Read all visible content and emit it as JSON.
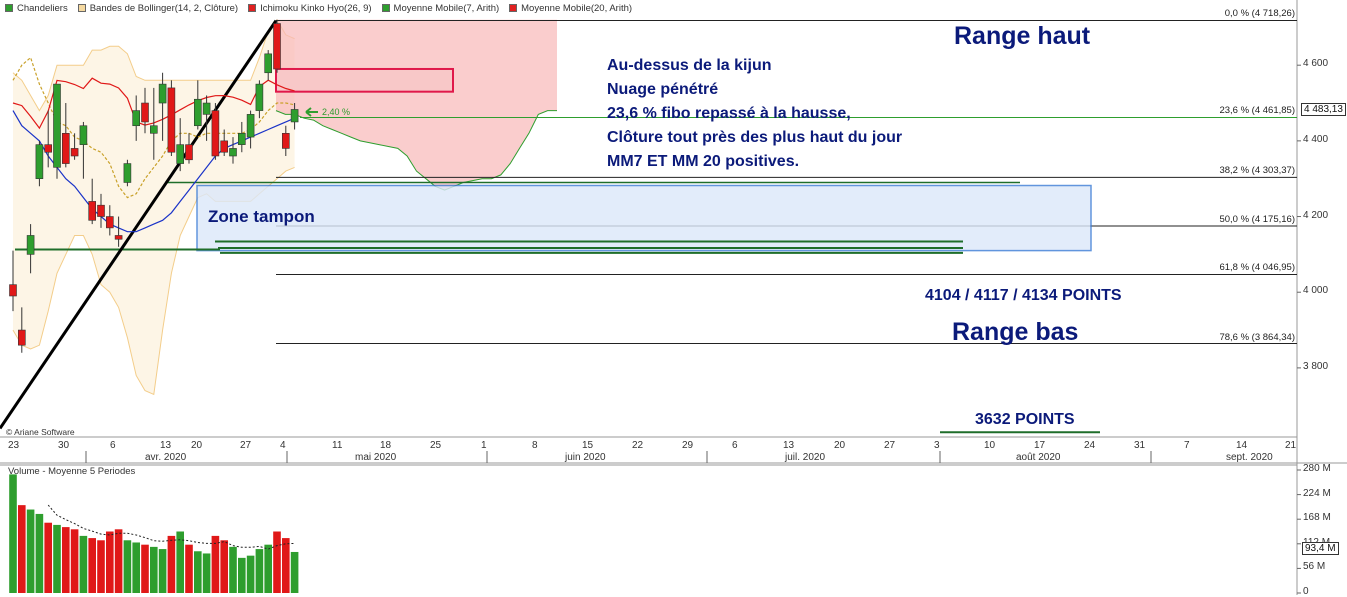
{
  "legend": [
    {
      "label": "Chandeliers",
      "color": "#2e9e2e"
    },
    {
      "label": "Bandes de Bollinger(14, 2, Clôture)",
      "color": "#f5d9a0"
    },
    {
      "label": "Ichimoku Kinko Hyo(26, 9)",
      "color": "#e02020"
    },
    {
      "label": "Moyenne Mobile(7, Arith)",
      "color": "#2e9e2e"
    },
    {
      "label": "Moyenne Mobile(20, Arith)",
      "color": "#e02020"
    }
  ],
  "volume_title": "Volume  - Moyenne 5 Periodes",
  "copyright": "© Ariane Software",
  "annotations": {
    "range_haut": "Range haut",
    "range_bas": "Range bas",
    "zone_tampon": "Zone tampon",
    "points_1": "4104 / 4117 / 4134 POINTS",
    "points_2": "3632 POINTS",
    "pct_label": "2,40 %",
    "comment_lines": [
      "Au-dessus de la kijun",
      "Nuage pénétré",
      "23,6 % fibo repassé à la hausse,",
      "Clôture tout près des plus haut du jour",
      "MM7 ET MM 20 positives."
    ]
  },
  "current_price": "4 483,13",
  "current_volume": "93,4 M",
  "colors": {
    "up": "#2e9e2e",
    "down": "#e01818",
    "cloud": "#f8b8b8",
    "bollinger": "#f5d9a0",
    "annotation": "#0b1a7a",
    "zone_fill": "#dce8fa",
    "zone_border": "#3a7bd5"
  },
  "chart_data": [
    {
      "type": "candlestick",
      "title": "",
      "ylim": [
        3620,
        4730
      ],
      "y_ticks": [
        "4 600",
        "4 400",
        "4 200",
        "4 000",
        "3 800"
      ],
      "y_tick_values": [
        4600,
        4400,
        4200,
        4000,
        3800
      ],
      "x_day_ticks": [
        "23",
        "30",
        "6",
        "13",
        "20",
        "27",
        "4",
        "11",
        "18",
        "25",
        "1",
        "8",
        "15",
        "22",
        "29",
        "6",
        "13",
        "20",
        "27",
        "3",
        "10",
        "17",
        "24",
        "31",
        "7",
        "14",
        "21"
      ],
      "x_month_labels": [
        "avr. 2020",
        "mai 2020",
        "juin 2020",
        "juil. 2020",
        "août 2020",
        "sept. 2020"
      ],
      "fibonacci": [
        {
          "level": "0,0 %",
          "value": 4718.26,
          "label": "0,0 % (4 718,26)"
        },
        {
          "level": "23,6 %",
          "value": 4461.85,
          "label": "23,6 % (4 461,85)"
        },
        {
          "level": "38,2 %",
          "value": 4303.37,
          "label": "38,2 % (4 303,37)"
        },
        {
          "level": "50,0 %",
          "value": 4175.16,
          "label": "50,0 % (4 175,16)"
        },
        {
          "level": "61,8 %",
          "value": 4046.95,
          "label": "61,8 % (4 046,95)"
        },
        {
          "level": "78,6 %",
          "value": 3864.34,
          "label": "78,6 % (3 864,34)"
        }
      ],
      "candles": [
        {
          "o": 4020,
          "h": 4110,
          "l": 3950,
          "c": 3990
        },
        {
          "o": 3900,
          "h": 3960,
          "l": 3840,
          "c": 3860
        },
        {
          "o": 4100,
          "h": 4180,
          "l": 4050,
          "c": 4150
        },
        {
          "o": 4300,
          "h": 4400,
          "l": 4280,
          "c": 4390
        },
        {
          "o": 4390,
          "h": 4480,
          "l": 4330,
          "c": 4370
        },
        {
          "o": 4330,
          "h": 4500,
          "l": 4300,
          "c": 4550
        },
        {
          "o": 4420,
          "h": 4500,
          "l": 4330,
          "c": 4340
        },
        {
          "o": 4380,
          "h": 4420,
          "l": 4350,
          "c": 4360
        },
        {
          "o": 4390,
          "h": 4450,
          "l": 4300,
          "c": 4440
        },
        {
          "o": 4240,
          "h": 4300,
          "l": 4180,
          "c": 4190
        },
        {
          "o": 4230,
          "h": 4260,
          "l": 4170,
          "c": 4200
        },
        {
          "o": 4200,
          "h": 4230,
          "l": 4150,
          "c": 4170
        },
        {
          "o": 4150,
          "h": 4200,
          "l": 4120,
          "c": 4140
        },
        {
          "o": 4290,
          "h": 4350,
          "l": 4280,
          "c": 4340
        },
        {
          "o": 4440,
          "h": 4520,
          "l": 4400,
          "c": 4480
        },
        {
          "o": 4500,
          "h": 4540,
          "l": 4420,
          "c": 4450
        },
        {
          "o": 4420,
          "h": 4540,
          "l": 4350,
          "c": 4440
        },
        {
          "o": 4500,
          "h": 4580,
          "l": 4400,
          "c": 4550
        },
        {
          "o": 4540,
          "h": 4560,
          "l": 4360,
          "c": 4370
        },
        {
          "o": 4340,
          "h": 4460,
          "l": 4320,
          "c": 4390
        },
        {
          "o": 4390,
          "h": 4420,
          "l": 4340,
          "c": 4350
        },
        {
          "o": 4440,
          "h": 4560,
          "l": 4430,
          "c": 4510
        },
        {
          "o": 4470,
          "h": 4520,
          "l": 4400,
          "c": 4500
        },
        {
          "o": 4480,
          "h": 4500,
          "l": 4350,
          "c": 4360
        },
        {
          "o": 4400,
          "h": 4430,
          "l": 4360,
          "c": 4370
        },
        {
          "o": 4360,
          "h": 4410,
          "l": 4340,
          "c": 4380
        },
        {
          "o": 4390,
          "h": 4450,
          "l": 4370,
          "c": 4420
        },
        {
          "o": 4410,
          "h": 4480,
          "l": 4380,
          "c": 4470
        },
        {
          "o": 4480,
          "h": 4560,
          "l": 4460,
          "c": 4550
        },
        {
          "o": 4580,
          "h": 4640,
          "l": 4560,
          "c": 4630
        },
        {
          "o": 4710,
          "h": 4720,
          "l": 4580,
          "c": 4590
        },
        {
          "o": 4420,
          "h": 4440,
          "l": 4360,
          "c": 4380
        },
        {
          "o": 4450,
          "h": 4500,
          "l": 4430,
          "c": 4483
        }
      ],
      "overlays": {
        "cloud": {
          "x_start_idx": 31,
          "top": [
            4720,
            4720,
            4720,
            4720,
            4720,
            4720,
            4720,
            4720,
            4720,
            4720,
            4720,
            4720,
            4720,
            4720,
            4720,
            4720,
            4720,
            4720,
            4720,
            4720,
            4720,
            4720,
            4720,
            4720,
            4720,
            4720,
            4720,
            4720,
            4720,
            4720,
            4720,
            4720,
            4720,
            4720,
            4720,
            4720,
            4720,
            4720,
            4720,
            4720,
            4720,
            4720,
            4720,
            4720,
            4720,
            4720,
            4720,
            4720,
            4720,
            4720,
            4720,
            4720,
            4720,
            4720,
            4720,
            4720,
            4720,
            4720,
            4720,
            4720,
            4720,
            4720,
            4720,
            4720,
            4720,
            4720,
            4720,
            4720,
            4720,
            4720,
            4720,
            4720,
            4720,
            4720,
            4720,
            4720,
            4720,
            4720,
            4720,
            4720,
            4720,
            4720,
            4720,
            4720,
            4720,
            4720,
            4720,
            4720,
            4720,
            4720,
            4720,
            4720,
            4720,
            4720,
            4720,
            4720,
            4720,
            4720,
            4720,
            4720
          ]
        },
        "span_b": [
          4480,
          4470,
          4470,
          4460,
          4455,
          4440,
          4430,
          4420,
          4410,
          4400,
          4395,
          4390,
          4385,
          4380,
          4360,
          4320,
          4300,
          4280,
          4270,
          4280,
          4290,
          4295,
          4300,
          4300,
          4310,
          4340,
          4380,
          4420,
          4470,
          4480,
          4480
        ]
      },
      "bollinger_upper": [
        4580,
        4560,
        4520,
        4480,
        4520,
        4600,
        4600,
        4600,
        4600,
        4640,
        4640,
        4650,
        4650,
        4630,
        4570,
        4560,
        4560,
        4560,
        4560,
        4560,
        4560,
        4560,
        4560,
        4560,
        4560,
        4560,
        4560,
        4560,
        4620,
        4690,
        4720,
        4680,
        4670
      ],
      "bollinger_lower": [
        3900,
        3860,
        3850,
        3860,
        3950,
        4050,
        4100,
        4150,
        4150,
        4100,
        4020,
        4000,
        3960,
        3880,
        3780,
        3740,
        3730,
        3900,
        4050,
        4150,
        4200,
        4250,
        4260,
        4240,
        4240,
        4240,
        4240,
        4240,
        4260,
        4280,
        4300,
        4320,
        4330
      ],
      "ma7": [
        4560,
        4600,
        4620,
        4550,
        4500,
        4450,
        4440,
        4410,
        4400,
        4380,
        4370,
        4340,
        4280,
        4250,
        4260,
        4300,
        4330,
        4360,
        4400,
        4420,
        4420,
        4410,
        4420,
        4420,
        4420,
        4420,
        4420,
        4430,
        4450,
        4480,
        4500,
        4500,
        4495
      ],
      "ma20": [
        4480,
        4440,
        4420,
        4400,
        4360,
        4330,
        4300,
        4280,
        4250,
        4220,
        4200,
        4180,
        4170,
        4160,
        4160,
        4170,
        4180,
        4190,
        4210,
        4240,
        4270,
        4300,
        4330,
        4360,
        4380,
        4390,
        4400,
        4410,
        4420,
        4430,
        4440,
        4450,
        4460
      ]
    },
    {
      "type": "bar",
      "title": "Volume  - Moyenne 5 Periodes",
      "ylim": [
        0,
        280
      ],
      "y_ticks": [
        "280 M",
        "224 M",
        "168 M",
        "112 M",
        "56 M",
        "0"
      ],
      "y_tick_values": [
        280,
        224,
        168,
        112,
        56,
        0
      ],
      "values": [
        270,
        200,
        190,
        180,
        160,
        155,
        150,
        145,
        130,
        125,
        120,
        140,
        145,
        120,
        115,
        110,
        105,
        100,
        130,
        140,
        110,
        95,
        90,
        130,
        120,
        105,
        80,
        85,
        100,
        110,
        140,
        125,
        93.4
      ],
      "up": [
        true,
        false,
        true,
        true,
        false,
        true,
        false,
        false,
        true,
        false,
        false,
        false,
        false,
        true,
        true,
        false,
        true,
        true,
        false,
        true,
        false,
        true,
        true,
        false,
        false,
        true,
        true,
        true,
        true,
        true,
        false,
        false,
        true
      ],
      "ma5": [
        null,
        null,
        null,
        null,
        200,
        177,
        167,
        158,
        147,
        141,
        134,
        132,
        136,
        136,
        132,
        126,
        119,
        118,
        120,
        121,
        119,
        115,
        113,
        113,
        117,
        108,
        104,
        104,
        106,
        100,
        108,
        112,
        113
      ]
    }
  ]
}
